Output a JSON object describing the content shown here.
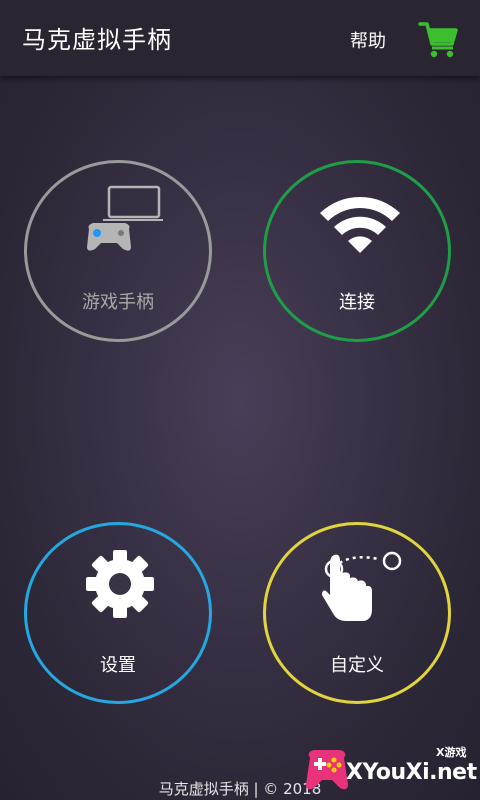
{
  "header": {
    "title": "马克虚拟手柄",
    "help_label": "帮助",
    "cart_icon": "shopping-cart-icon",
    "cart_color": "#3cbf2f"
  },
  "menu": {
    "gamepad": {
      "label": "游戏手柄",
      "icon": "laptop-gamepad-icon",
      "ring_color": "#9a9a9a"
    },
    "connect": {
      "label": "连接",
      "icon": "wifi-icon",
      "ring_color": "#1f9e47"
    },
    "settings": {
      "label": "设置",
      "icon": "gear-icon",
      "ring_color": "#25a7e0"
    },
    "custom": {
      "label": "自定义",
      "icon": "touch-gesture-icon",
      "ring_color": "#e2d43c"
    }
  },
  "footer": {
    "text": "马克虚拟手柄 | © 2018"
  },
  "watermark": {
    "small_text": "X游戏",
    "brand_text": "XYouXi.net"
  }
}
